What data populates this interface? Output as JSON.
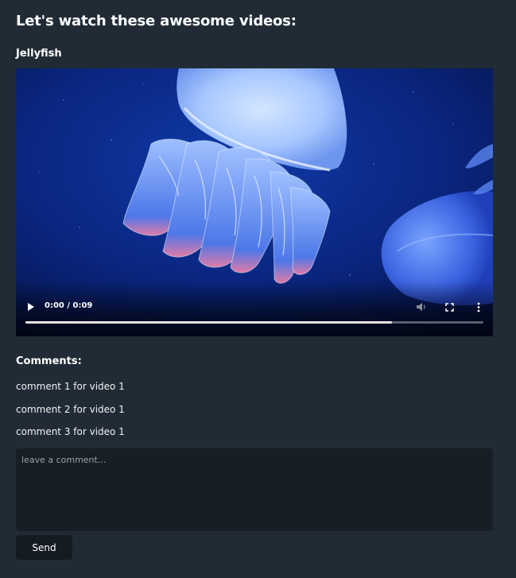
{
  "page": {
    "title": "Let's watch these awesome videos:"
  },
  "video": {
    "title": "Jellyfish",
    "time_display": "0:00 / 0:09",
    "progress_fraction": 0.8,
    "icons": {
      "play": "play-icon",
      "volume": "volume-icon",
      "fullscreen": "fullscreen-icon",
      "menu": "more-vert-icon"
    }
  },
  "comments": {
    "heading": "Comments:",
    "items": [
      "comment 1 for video 1",
      "comment 2 for video 1",
      "comment 3 for video 1"
    ],
    "input": {
      "placeholder": "leave a comment...",
      "value": ""
    },
    "send_label": "Send"
  },
  "colors": {
    "background": "#202b36",
    "input_bg": "#171e25",
    "button_bg": "#141b22",
    "text": "#ffffff"
  }
}
